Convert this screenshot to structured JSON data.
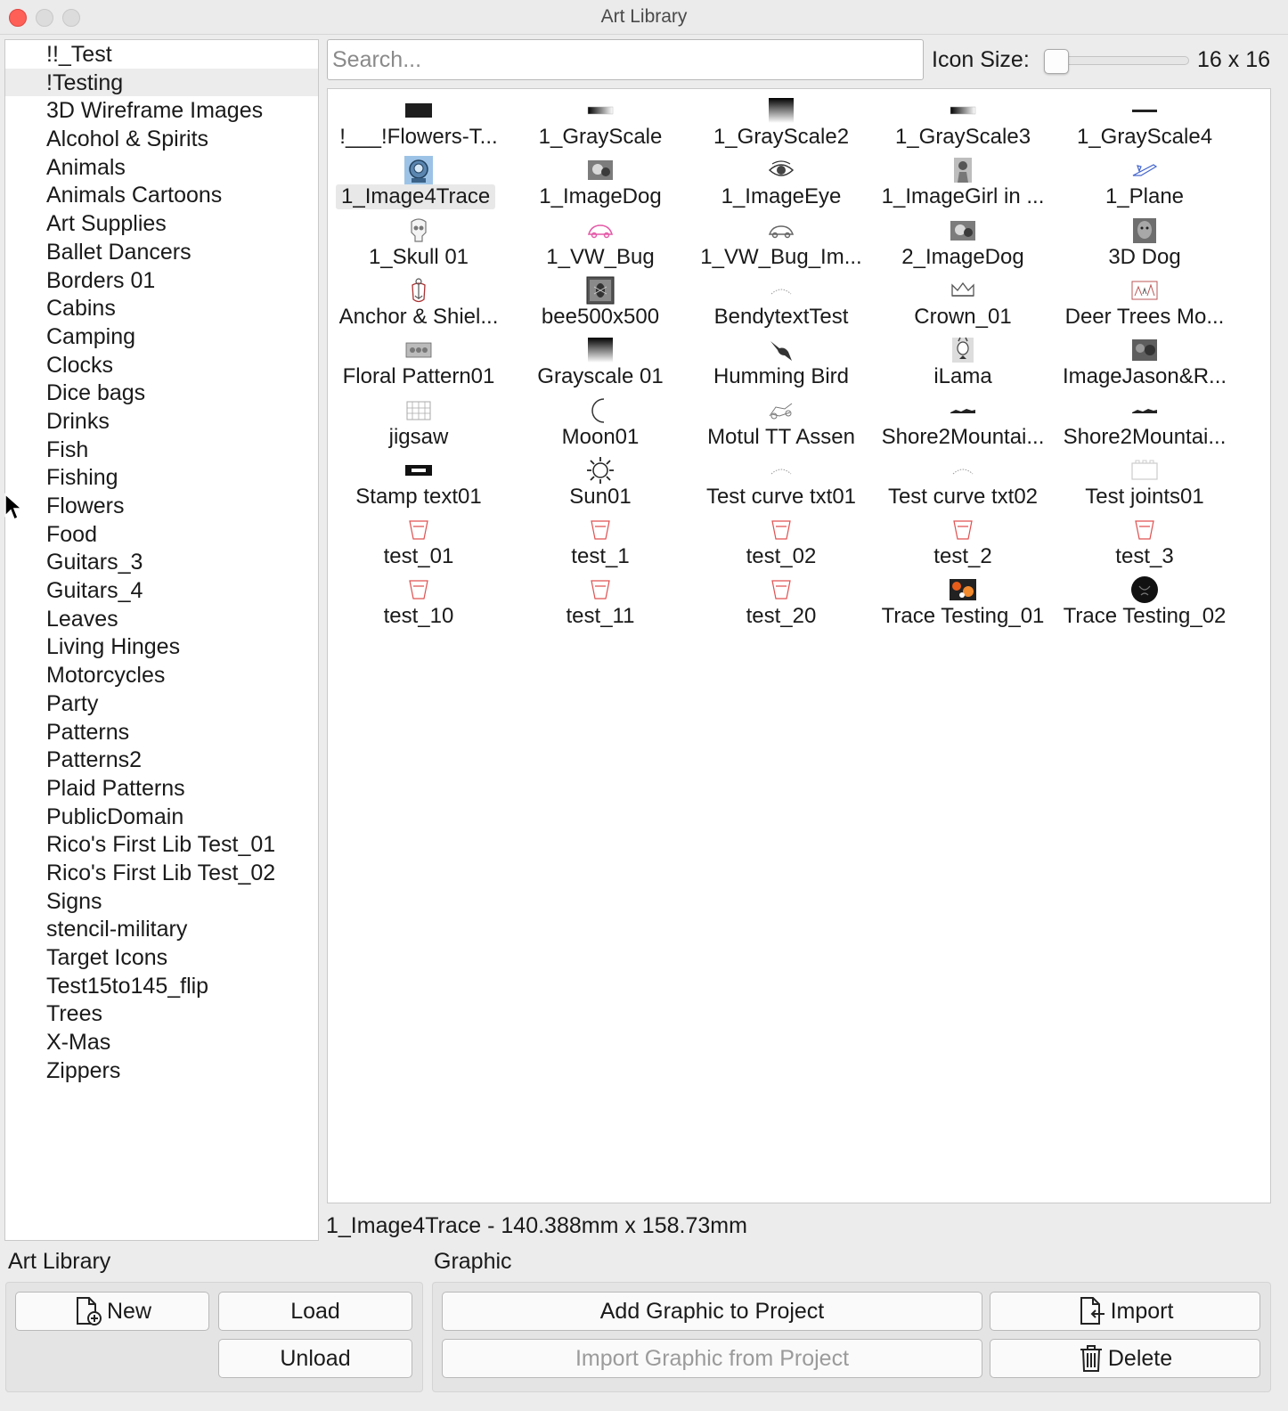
{
  "window": {
    "title": "Art Library"
  },
  "sidebar": {
    "selected": "!Testing",
    "items": [
      "!!_Test",
      "!Testing",
      "3D Wireframe Images",
      "Alcohol & Spirits",
      "Animals",
      "Animals Cartoons",
      "Art Supplies",
      "Ballet Dancers",
      "Borders 01",
      "Cabins",
      "Camping",
      "Clocks",
      "Dice bags",
      "Drinks",
      "Fish",
      "Fishing",
      "Flowers",
      "Food",
      "Guitars_3",
      "Guitars_4",
      "Leaves",
      "Living Hinges",
      "Motorcycles",
      "Party",
      "Patterns",
      "Patterns2",
      "Plaid Patterns",
      "PublicDomain",
      "Rico's First Lib Test_01",
      "Rico's First Lib Test_02",
      "Signs",
      "stencil-military",
      "Target Icons",
      "Test15to145_flip",
      "Trees",
      "X-Mas",
      "Zippers"
    ]
  },
  "toolbar": {
    "search_placeholder": "Search...",
    "icon_size_label": "Icon Size:",
    "icon_size_value": "16 x 16",
    "icon_size_slider_fraction": 0.0
  },
  "grid": {
    "selected": "1_Image4Trace",
    "items": [
      {
        "label": "!___!Flowers-T...",
        "icon": "dark-rect-thumb"
      },
      {
        "label": "1_GrayScale",
        "icon": "gradient-bar-thumb"
      },
      {
        "label": "1_GrayScale2",
        "icon": "gradient-square-thumb"
      },
      {
        "label": "1_GrayScale3",
        "icon": "gradient-bar-thumb"
      },
      {
        "label": "1_GrayScale4",
        "icon": "thin-bar-thumb"
      },
      {
        "label": "1_Image4Trace",
        "icon": "diver-helmet-thumb"
      },
      {
        "label": "1_ImageDog",
        "icon": "dog-photo-thumb"
      },
      {
        "label": "1_ImageEye",
        "icon": "eye-thumb"
      },
      {
        "label": "1_ImageGirl in ...",
        "icon": "girl-photo-thumb"
      },
      {
        "label": "1_Plane",
        "icon": "plane-outline-thumb"
      },
      {
        "label": "1_Skull 01",
        "icon": "skull-thumb"
      },
      {
        "label": "1_VW_Bug",
        "icon": "vw-bug-pink-thumb"
      },
      {
        "label": "1_VW_Bug_Im...",
        "icon": "vw-bug-gray-thumb"
      },
      {
        "label": "2_ImageDog",
        "icon": "dog-photo-thumb"
      },
      {
        "label": "3D Dog",
        "icon": "dog-3d-thumb"
      },
      {
        "label": "Anchor & Shiel...",
        "icon": "anchor-shield-thumb"
      },
      {
        "label": "bee500x500",
        "icon": "bee-tile-thumb"
      },
      {
        "label": "BendytextTest",
        "icon": "curved-text-thumb"
      },
      {
        "label": "Crown_01",
        "icon": "crown-thumb"
      },
      {
        "label": "Deer Trees Mo...",
        "icon": "deer-trees-thumb"
      },
      {
        "label": "Floral Pattern01",
        "icon": "floral-pattern-thumb"
      },
      {
        "label": "Grayscale 01",
        "icon": "gradient-square-thumb"
      },
      {
        "label": "Humming Bird",
        "icon": "hummingbird-thumb"
      },
      {
        "label": "iLama",
        "icon": "llama-thumb"
      },
      {
        "label": "ImageJason&R...",
        "icon": "photo-thumb"
      },
      {
        "label": "jigsaw",
        "icon": "jigsaw-thumb"
      },
      {
        "label": "Moon01",
        "icon": "moon-thumb"
      },
      {
        "label": "Motul TT Assen",
        "icon": "motorcycle-sketch-thumb"
      },
      {
        "label": "Shore2Mountai...",
        "icon": "silhouette-bar-thumb"
      },
      {
        "label": "Shore2Mountai...",
        "icon": "silhouette-bar-thumb"
      },
      {
        "label": "Stamp text01",
        "icon": "stamp-thumb"
      },
      {
        "label": "Sun01",
        "icon": "sun-thumb"
      },
      {
        "label": "Test curve txt01",
        "icon": "curved-text-thumb"
      },
      {
        "label": "Test curve txt02",
        "icon": "curved-text-thumb"
      },
      {
        "label": "Test joints01",
        "icon": "box-outline-thumb"
      },
      {
        "label": "test_01",
        "icon": "red-outline-thumb"
      },
      {
        "label": "test_1",
        "icon": "red-outline-thumb"
      },
      {
        "label": "test_02",
        "icon": "red-outline-thumb"
      },
      {
        "label": "test_2",
        "icon": "red-outline-thumb"
      },
      {
        "label": "test_3",
        "icon": "red-outline-thumb"
      },
      {
        "label": "test_10",
        "icon": "red-outline-thumb"
      },
      {
        "label": "test_11",
        "icon": "red-outline-thumb"
      },
      {
        "label": "test_20",
        "icon": "red-outline-thumb"
      },
      {
        "label": "Trace Testing_01",
        "icon": "color-photo-thumb"
      },
      {
        "label": "Trace Testing_02",
        "icon": "black-circle-thumb"
      }
    ]
  },
  "status": {
    "text": "1_Image4Trace - 140.388mm x 158.73mm"
  },
  "library_section": {
    "label": "Art Library",
    "new_label": "New",
    "load_label": "Load",
    "unload_label": "Unload"
  },
  "graphic_section": {
    "label": "Graphic",
    "add_label": "Add Graphic to Project",
    "import_label": "Import",
    "import_from_project_label": "Import Graphic from Project",
    "delete_label": "Delete"
  }
}
